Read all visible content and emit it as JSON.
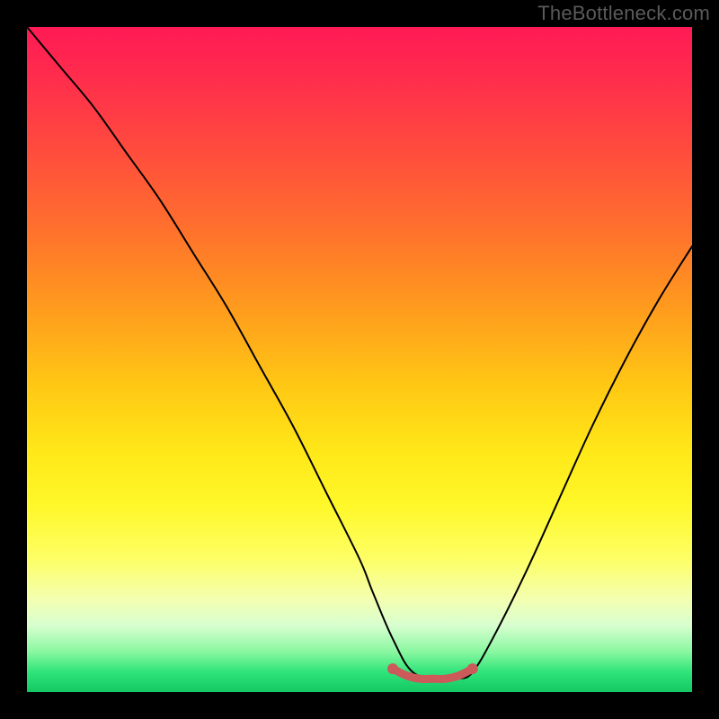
{
  "watermark": "TheBottleneck.com",
  "chart_data": {
    "type": "line",
    "title": "",
    "xlabel": "",
    "ylabel": "",
    "xlim": [
      0,
      100
    ],
    "ylim": [
      0,
      100
    ],
    "series": [
      {
        "name": "bottleneck-curve",
        "x": [
          0,
          5,
          10,
          15,
          20,
          25,
          30,
          35,
          40,
          45,
          50,
          52,
          55,
          58,
          62,
          65,
          67,
          70,
          75,
          80,
          85,
          90,
          95,
          100
        ],
        "values": [
          100,
          94,
          88,
          81,
          74,
          66,
          58,
          49,
          40,
          30,
          20,
          15,
          8,
          3,
          2,
          2,
          3,
          8,
          18,
          29,
          40,
          50,
          59,
          67
        ]
      },
      {
        "name": "flat-bottom-segment",
        "x": [
          55,
          57,
          59,
          61,
          63,
          65,
          67
        ],
        "values": [
          3.5,
          2.5,
          2.0,
          2.0,
          2.0,
          2.5,
          3.5
        ]
      }
    ],
    "colors": {
      "curve": "#000000",
      "flat_segment": "#cc5a5a",
      "gradient_top": "#ff1a55",
      "gradient_mid": "#ffe818",
      "gradient_bottom": "#14c862",
      "frame": "#000000"
    }
  }
}
